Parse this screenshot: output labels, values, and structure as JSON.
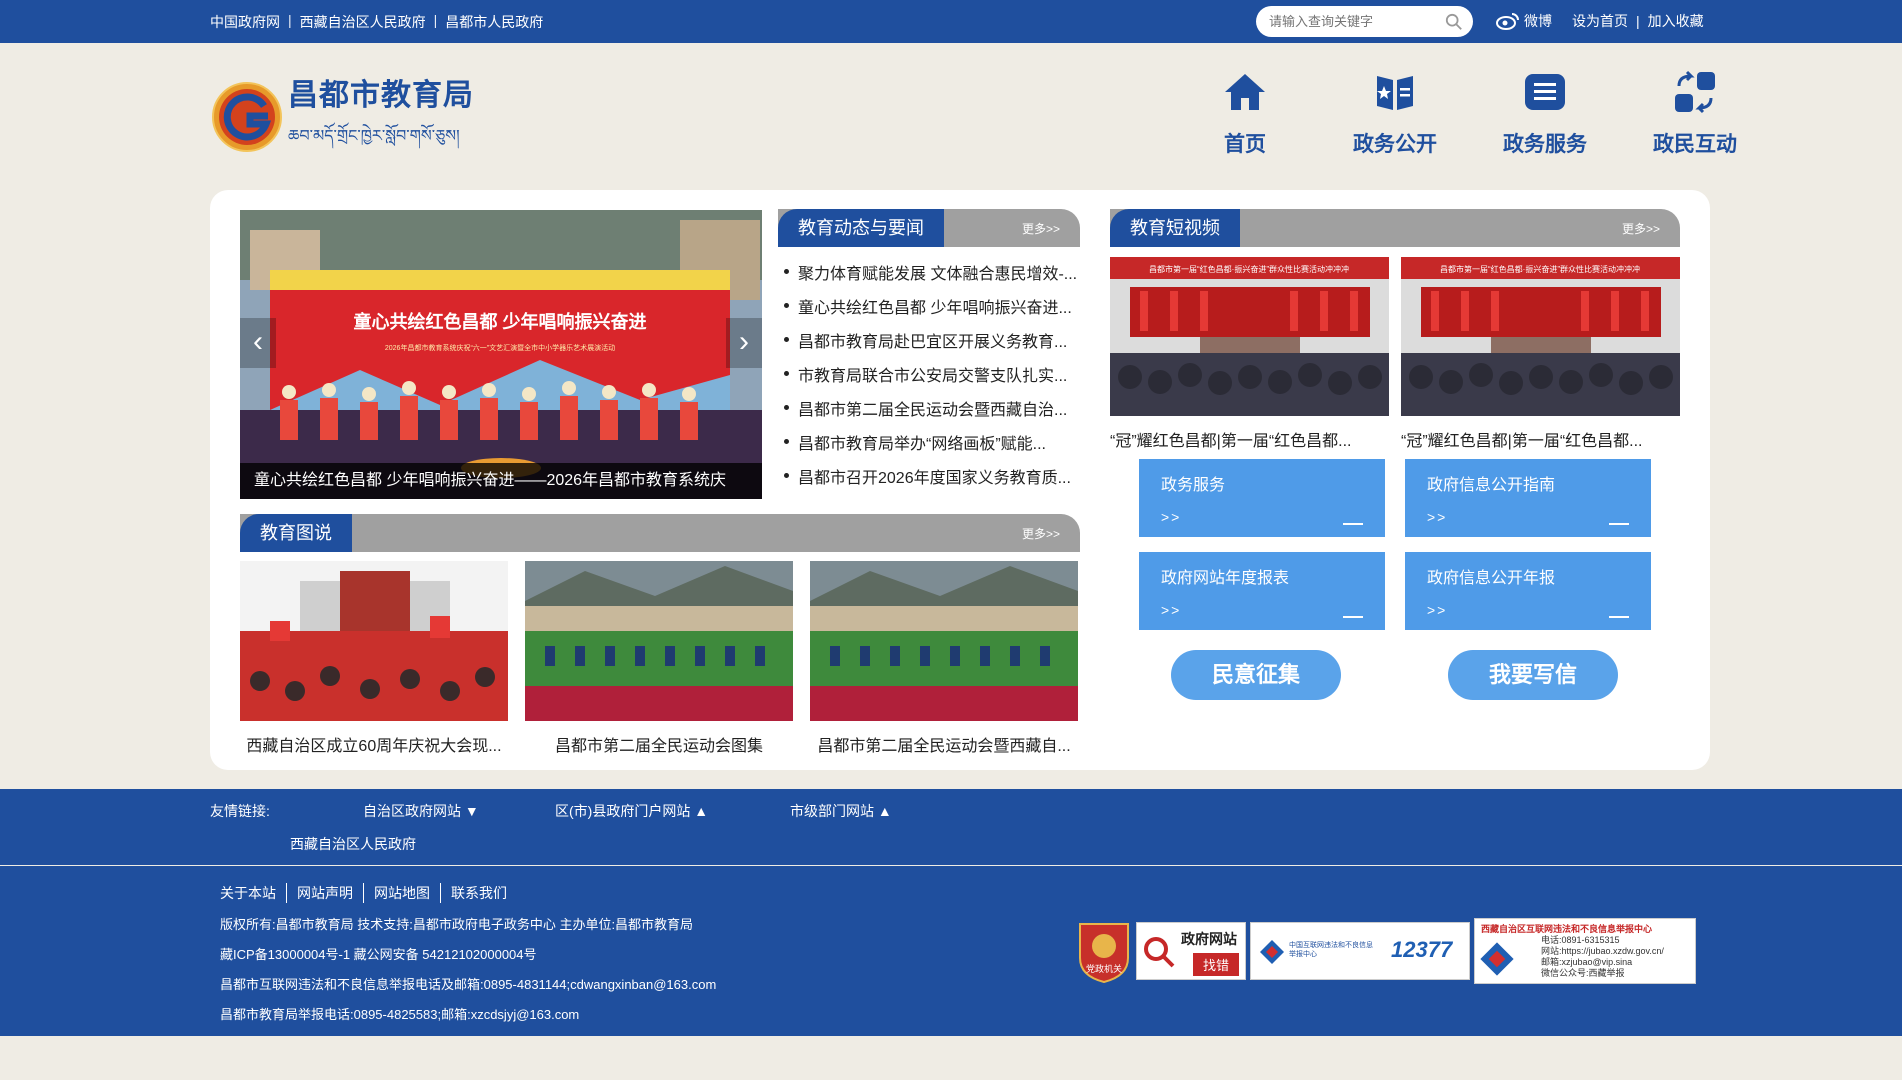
{
  "topbar": {
    "links": [
      "中国政府网",
      "西藏自治区人民政府",
      "昌都市人民政府"
    ],
    "search_placeholder": "请输入查询关键字",
    "weibo": "微博",
    "set_home": "设为首页",
    "favorite": "加入收藏"
  },
  "header": {
    "title": "昌都市教育局",
    "subtitle_tibetan": "ཆབ་མདོ་གྲོང་ཁྱེར་སློབ་གསོ་ཅུས།"
  },
  "nav": [
    {
      "label": "首页",
      "icon": "home-icon"
    },
    {
      "label": "政务公开",
      "icon": "book-icon"
    },
    {
      "label": "政务服务",
      "icon": "list-icon"
    },
    {
      "label": "政民互动",
      "icon": "exchange-icon"
    }
  ],
  "carousel": {
    "banner_text": "童心共绘红色昌都 少年唱响振兴奋进",
    "banner_sub": "2026年昌都市教育系统庆祝“六一”文艺汇演暨全市中小学器乐艺术展演活动",
    "caption": "童心共绘红色昌都 少年唱响振兴奋进——2026年昌都市教育系统庆",
    "prev": "‹",
    "next": "›"
  },
  "news": {
    "title": "教育动态与要闻",
    "more": "更多>>",
    "items": [
      "聚力体育赋能发展 文体融合惠民增效-...",
      "童心共绘红色昌都 少年唱响振兴奋进...",
      "昌都市教育局赴巴宜区开展义务教育...",
      "市教育局联合市公安局交警支队扎实...",
      "昌都市第二届全民运动会暨西藏自治...",
      "昌都市教育局举办“网络画板”赋能...",
      "昌都市召开2026年度国家义务教育质..."
    ]
  },
  "videos": {
    "title": "教育短视频",
    "more": "更多>>",
    "banner": "昌都市第一届“红色昌都·振兴奋进”群众性比赛活动冲冲冲",
    "items": [
      "“冠”耀红色昌都|第一届“红色昌都...",
      "“冠”耀红色昌都|第一届“红色昌都..."
    ]
  },
  "services": [
    {
      "title": "政务服务",
      "go": ">>"
    },
    {
      "title": "政府信息公开指南",
      "go": ">>"
    },
    {
      "title": "政府网站年度报表",
      "go": ">>"
    },
    {
      "title": "政府信息公开年报",
      "go": ">>"
    }
  ],
  "buttons": {
    "survey": "民意征集",
    "letter": "我要写信"
  },
  "photos": {
    "title": "教育图说",
    "more": "更多>>",
    "items": [
      "西藏自治区成立60周年庆祝大会现...",
      "昌都市第二届全民运动会图集",
      "昌都市第二届全民运动会暨西藏自..."
    ]
  },
  "friend_links": {
    "label": "友情链接:",
    "dropdowns": [
      {
        "label": "自治区政府网站",
        "arrow": "▼"
      },
      {
        "label": "区(市)县政府门户网站",
        "arrow": "▲"
      },
      {
        "label": "市级部门网站",
        "arrow": "▲"
      }
    ],
    "expanded_item": "西藏自治区人民政府"
  },
  "footer": {
    "menu": [
      "关于本站",
      "网站声明",
      "网站地图",
      "联系我们"
    ],
    "lines": [
      "版权所有:昌都市教育局    技术支持:昌都市政府电子政务中心    主办单位:昌都市教育局",
      "藏ICP备13000004号-1      藏公网安备 54212102000004号",
      "昌都市互联网违法和不良信息举报电话及邮箱:0895-4831144;cdwangxinban@163.com",
      "昌都市教育局举报电话:0895-4825583;邮箱:xzcdsjyj@163.com"
    ],
    "badges": {
      "party": "党政机关",
      "wangzhan": "政府网站",
      "zhaocuo": "找错",
      "report_center": "中国互联网违法和不良信息举报中心",
      "hotline": "12377",
      "tibet_title": "西藏自治区互联网违法和不良信息举报中心",
      "tibet_lines": [
        "电话:0891-6315315",
        "网站:https://jubao.xzdw.gov.cn/",
        "邮箱:xzjubao@vip.sina",
        "微信公众号:西藏举报"
      ]
    }
  },
  "colors": {
    "primary": "#1f4f9e",
    "service": "#4f9be8",
    "pill": "#5aa3ea",
    "grey_bar": "#a0a0a0",
    "bg": "#efece4"
  }
}
